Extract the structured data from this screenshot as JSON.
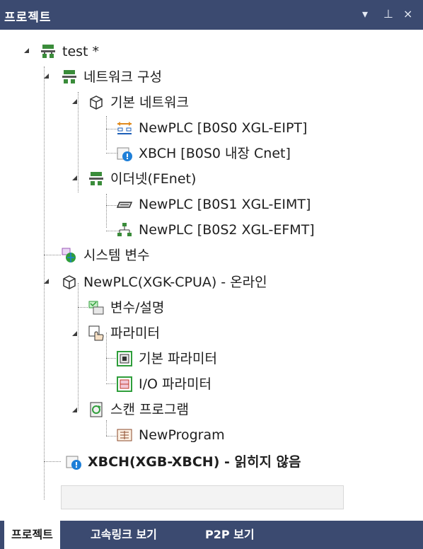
{
  "panel": {
    "title": "프로젝트",
    "dropdown_glyph": "▾",
    "pin_glyph": "⊥",
    "close_glyph": "×"
  },
  "tree": {
    "root": {
      "label": "test *",
      "icon": "network-icon"
    },
    "network_config": {
      "label": "네트워크 구성",
      "icon": "network-icon"
    },
    "basic_network": {
      "label": "기본 네트워크",
      "icon": "cube-icon"
    },
    "basic_newplc": {
      "label": "NewPLC [B0S0 XGL-EIPT]",
      "icon": "eip-icon"
    },
    "basic_xbch": {
      "label": "XBCH [B0S0 내장 Cnet]",
      "icon": "xbch-icon"
    },
    "ethernet": {
      "label": "이더넷(FEnet)",
      "icon": "network-icon"
    },
    "eth_newplc1": {
      "label": "NewPLC [B0S1 XGL-EIMT]",
      "icon": "plate-icon"
    },
    "eth_newplc2": {
      "label": "NewPLC [B0S2 XGL-EFMT]",
      "icon": "topology-icon"
    },
    "system_vars": {
      "label": "시스템 변수",
      "icon": "globe-var-icon"
    },
    "cpu": {
      "label": "NewPLC(XGK-CPUA) - 온라인",
      "icon": "cube-icon"
    },
    "var_comment": {
      "label": "변수/설명",
      "icon": "var-comment-icon"
    },
    "params": {
      "label": "파라미터",
      "icon": "hand-param-icon"
    },
    "basic_params": {
      "label": "기본 파라미터",
      "icon": "basic-param-icon"
    },
    "io_params": {
      "label": "I/O 파라미터",
      "icon": "io-param-icon"
    },
    "scan_program": {
      "label": "스캔 프로그램",
      "icon": "scan-icon"
    },
    "new_program": {
      "label": "NewProgram",
      "icon": "program-icon"
    },
    "xbch_cpu": {
      "label": "XBCH(XGB-XBCH) - 읽히지 않음",
      "icon": "xbch-icon"
    }
  },
  "tabs": [
    {
      "label": "프로젝트",
      "active": true
    },
    {
      "label": "고속링크 보기",
      "active": false
    },
    {
      "label": "P2P 보기",
      "active": false
    }
  ],
  "colors": {
    "titlebar_bg": "#3b4a70",
    "accent_blue": "#1e7fd8",
    "green": "#2f9e3b"
  }
}
